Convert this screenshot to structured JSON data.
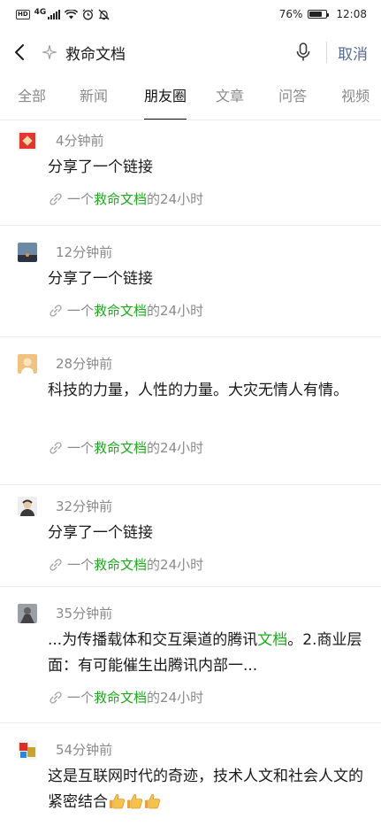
{
  "status_bar": {
    "hd": "HD",
    "network": "4G",
    "battery_percent": "76%",
    "battery_level": 0.76,
    "time": "12:08"
  },
  "search": {
    "query": "救命文档",
    "cancel_label": "取消"
  },
  "tabs": [
    {
      "label": "全部",
      "active": false
    },
    {
      "label": "新闻",
      "active": false
    },
    {
      "label": "朋友圈",
      "active": true
    },
    {
      "label": "文章",
      "active": false
    },
    {
      "label": "问答",
      "active": false
    },
    {
      "label": "视频",
      "active": false
    }
  ],
  "highlight_color": "#1aad19",
  "posts": [
    {
      "time": "4分钟前",
      "content": [
        {
          "text": "分享了一个链接",
          "hl": false
        }
      ],
      "link": {
        "prefix": "一个",
        "keyword": "救命文档",
        "suffix": "的24小时"
      }
    },
    {
      "time": "12分钟前",
      "content": [
        {
          "text": "分享了一个链接",
          "hl": false
        }
      ],
      "link": {
        "prefix": "一个",
        "keyword": "救命文档",
        "suffix": "的24小时"
      }
    },
    {
      "time": "28分钟前",
      "content": [
        {
          "text": "科技的力量，人性的力量。大灾无情人有情。",
          "hl": false
        }
      ],
      "link": {
        "prefix": "一个",
        "keyword": "救命文档",
        "suffix": "的24小时"
      }
    },
    {
      "time": "32分钟前",
      "content": [
        {
          "text": "分享了一个链接",
          "hl": false
        }
      ],
      "link": {
        "prefix": "一个",
        "keyword": "救命文档",
        "suffix": "的24小时"
      }
    },
    {
      "time": "35分钟前",
      "content": [
        {
          "text": "...为传播载体和交互渠道的腾讯",
          "hl": false
        },
        {
          "text": "文档",
          "hl": true
        },
        {
          "text": "。2.商业层面：有可能催生出腾讯内部一...",
          "hl": false
        }
      ],
      "link": {
        "prefix": "一个",
        "keyword": "救命文档",
        "suffix": "的24小时"
      }
    },
    {
      "time": "54分钟前",
      "content": [
        {
          "text": "这是互联网时代的奇迹，技术人文和社会人文的紧密结合",
          "hl": false
        }
      ],
      "emoji_count": 3,
      "emoji_name": "thumbs-up-icon"
    }
  ]
}
